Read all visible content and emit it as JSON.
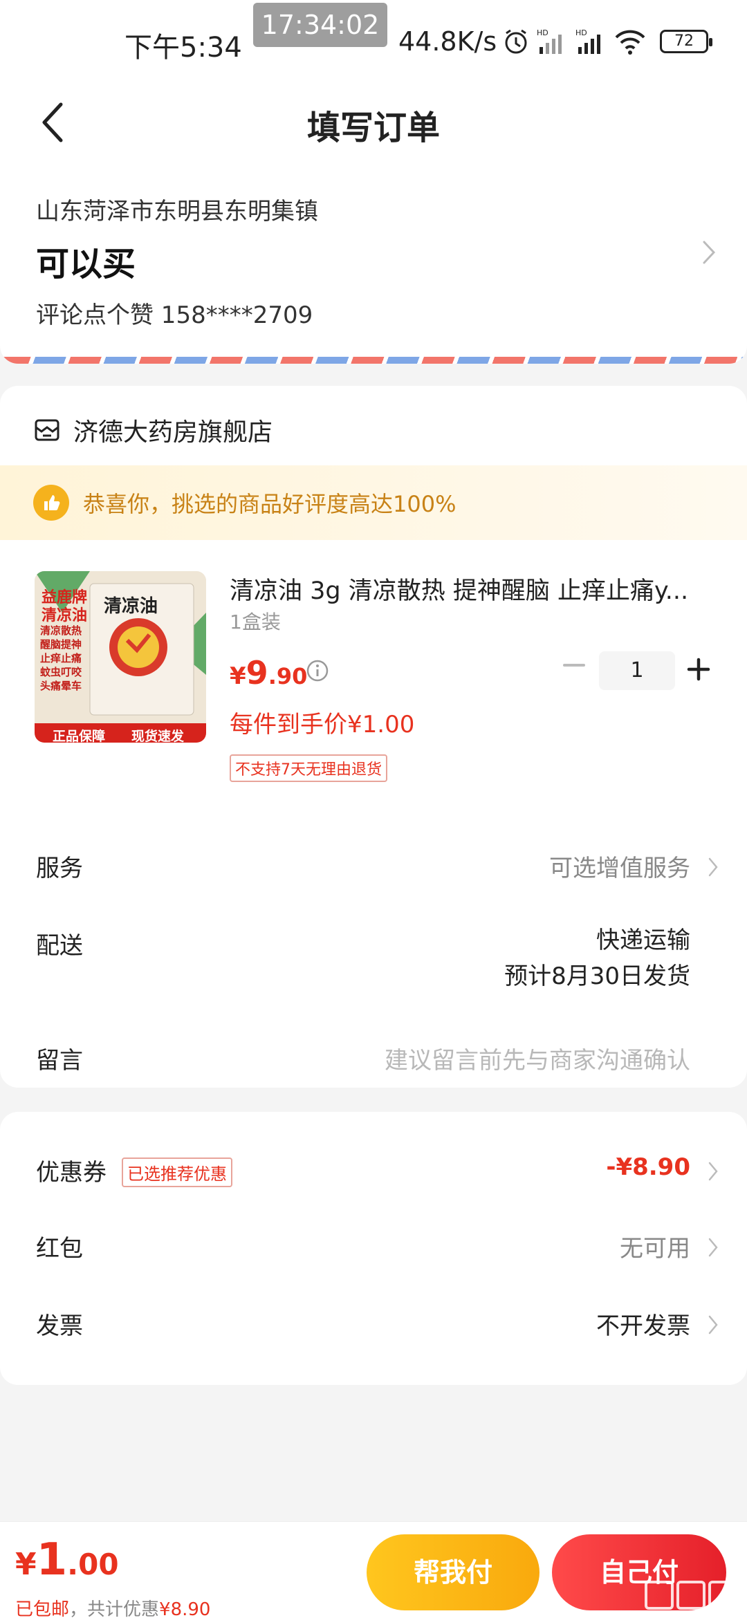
{
  "status_bar": {
    "time": "下午5:34",
    "clock_overlay": "17:34:02",
    "net_speed": "44.8K/s",
    "battery": "72"
  },
  "header": {
    "title": "填写订单"
  },
  "address": {
    "line": "山东菏泽市东明县东明集镇",
    "name": "可以买",
    "contact": "评论点个赞  158****2709"
  },
  "store": {
    "name": "济德大药房旗舰店",
    "banner": "恭喜你，挑选的商品好评度高达100%"
  },
  "product": {
    "title": "清凉油 3g 清凉散热 提神醒脑 止痒止痛y...",
    "spec": "1盒装",
    "price_currency": "¥",
    "price_int": "9",
    "price_dec": ".90",
    "unit_price": "每件到手价¥1.00",
    "return_policy": "不支持7天无理由退货",
    "quantity": "1",
    "image": {
      "brand": "益鹿牌",
      "name": "清凉油",
      "features": [
        "清凉散热",
        "醒脑提神",
        "止痒止痛",
        "蚊虫叮咬",
        "头痛晕车"
      ],
      "badge_left": "正品保障",
      "badge_right": "现货速发"
    }
  },
  "rows": {
    "service_label": "服务",
    "service_value": "可选增值服务",
    "delivery_label": "配送",
    "delivery_method": "快递运输",
    "delivery_eta": "预计8月30日发货",
    "message_label": "留言",
    "message_placeholder": "建议留言前先与商家沟通确认"
  },
  "discounts": {
    "coupon_label": "优惠券",
    "coupon_tag": "已选推荐优惠",
    "coupon_value": "-¥8.90",
    "redpacket_label": "红包",
    "redpacket_value": "无可用",
    "invoice_label": "发票",
    "invoice_value": "不开发票"
  },
  "bottom": {
    "total_currency": "¥",
    "total_int": "1",
    "total_dec": ".00",
    "shipping": "已包邮",
    "savings_prefix": "，共计优惠",
    "savings_value": "¥8.90",
    "help_pay": "帮我付",
    "self_pay": "自己付"
  },
  "colors": {
    "accent_red": "#e8321f",
    "banner_text": "#c88216",
    "help_pay_yellow": "#f9a90d"
  }
}
